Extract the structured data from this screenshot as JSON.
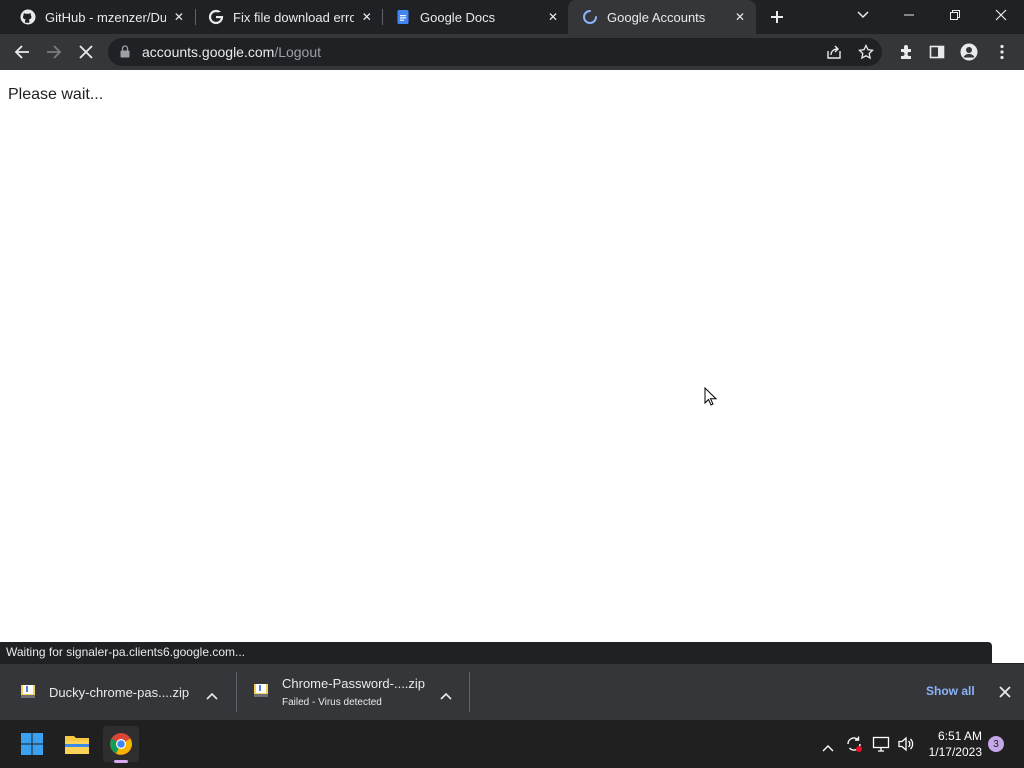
{
  "browser": {
    "tabs": [
      {
        "title": "GitHub - mzenzer/Duck",
        "icon": "github-icon",
        "active": false
      },
      {
        "title": "Fix file download errors",
        "icon": "google-icon",
        "active": false
      },
      {
        "title": "Google Docs",
        "icon": "google-docs-icon",
        "active": false
      },
      {
        "title": "Google Accounts",
        "icon": "loading-spinner-icon",
        "active": true
      }
    ],
    "new_tab_label": "+",
    "address": {
      "host": "accounts.google.com",
      "path": "/Logout"
    }
  },
  "page": {
    "message": "Please wait..."
  },
  "status_bubble": {
    "text": "Waiting for signaler-pa.clients6.google.com..."
  },
  "downloads": {
    "items": [
      {
        "name": "Ducky-chrome-pas....zip",
        "status": ""
      },
      {
        "name": "Chrome-Password-....zip",
        "status": "Failed - Virus detected"
      }
    ],
    "show_all_label": "Show all"
  },
  "taskbar": {
    "time": "6:51 AM",
    "date": "1/17/2023",
    "notification_count": "3"
  },
  "colors": {
    "titlebar": "#202124",
    "toolbar": "#35363a",
    "accent_link": "#8ab4f8",
    "taskbar": "#202020"
  }
}
